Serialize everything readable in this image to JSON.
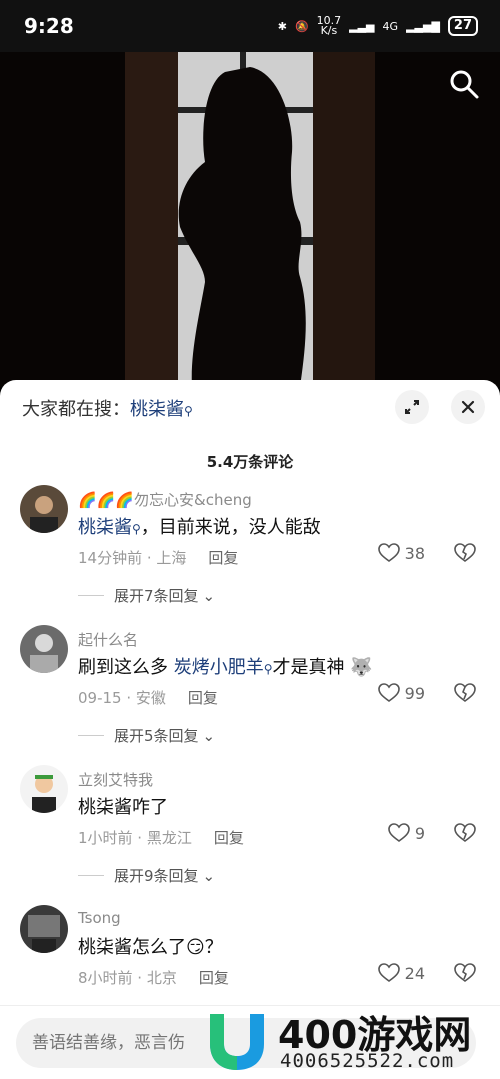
{
  "status": {
    "time": "9:28",
    "net_speed": "10.7",
    "net_unit": "K/s",
    "network": "4G",
    "battery": "27"
  },
  "sheet": {
    "hint_prefix": "大家都在搜：",
    "hint_keyword": "桃柒酱",
    "count": "5.4万条评论"
  },
  "comments": [
    {
      "user": "🌈🌈🌈勿忘心安&cheng",
      "keyword": "桃柒酱",
      "text_after": "，目前来说，没人能敌",
      "time_loc": "14分钟前 · 上海",
      "reply": "回复",
      "likes": "38",
      "expand": "展开7条回复"
    },
    {
      "user": "起什么名",
      "text_before": "刷到这么多 ",
      "keyword": "炭烤小肥羊",
      "text_after": "才是真神",
      "time_loc": "09-15 · 安徽",
      "reply": "回复",
      "likes": "99",
      "expand": "展开5条回复"
    },
    {
      "user": "立刻艾特我",
      "text": "桃柒酱咋了",
      "time_loc": "1小时前 · 黑龙江",
      "reply": "回复",
      "likes": "9",
      "expand": "展开9条回复"
    },
    {
      "user": "Tsong",
      "text": "桃柒酱怎么了",
      "text_after": "？",
      "time_loc": "8小时前 · 北京",
      "reply": "回复",
      "likes": "24"
    }
  ],
  "input": {
    "placeholder": "善语结善缘，恶言伤"
  },
  "watermark": {
    "title": "400游戏网",
    "phone": "4006525522.com"
  },
  "colors": {
    "keyword": "#1e3f7a",
    "watermark_blue": "#1a9be0"
  }
}
